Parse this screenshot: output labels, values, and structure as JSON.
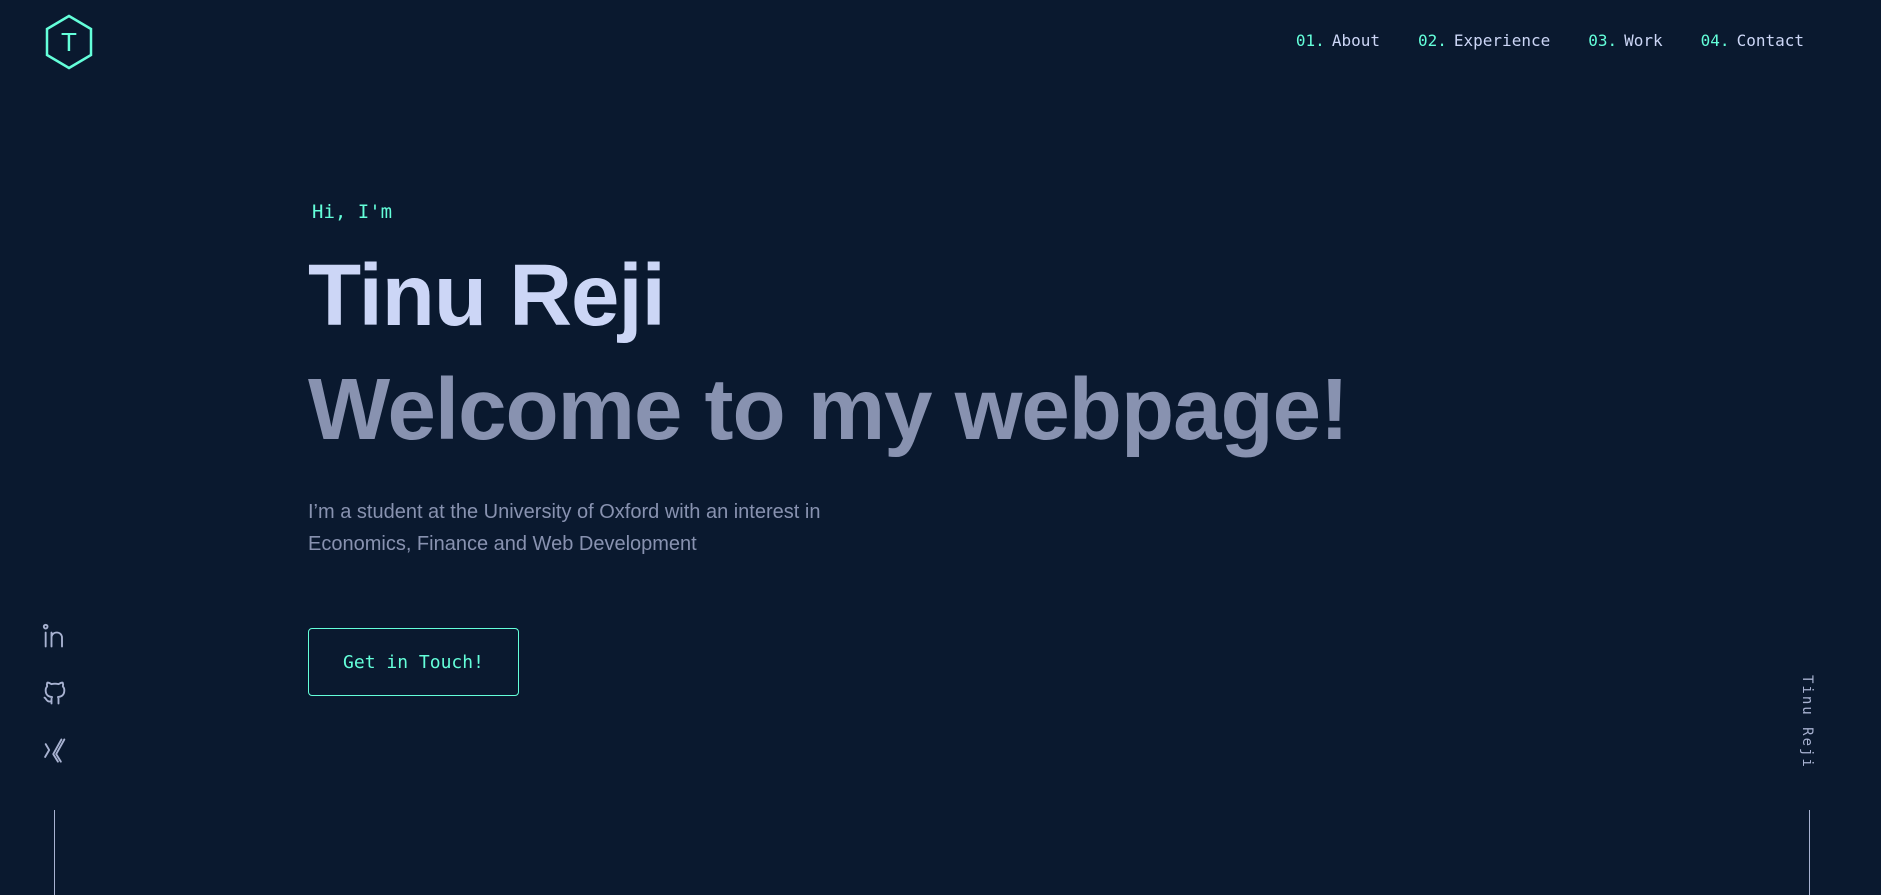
{
  "header": {
    "logo_letter": "T",
    "nav": [
      {
        "num": "01.",
        "label": "About"
      },
      {
        "num": "02.",
        "label": "Experience"
      },
      {
        "num": "03.",
        "label": "Work"
      },
      {
        "num": "04.",
        "label": "Contact"
      }
    ]
  },
  "hero": {
    "greeting": "Hi, I'm",
    "name": "Tinu Reji",
    "tagline": "Welcome to my webpage!",
    "bio": "I’m a student at the University of Oxford with an interest in Economics, Finance and Web Development",
    "cta_label": "Get in Touch!"
  },
  "socials": [
    {
      "icon": "linkedin-icon"
    },
    {
      "icon": "github-icon"
    },
    {
      "icon": "xing-icon"
    }
  ],
  "side": {
    "vertical_name": "Tinu Reji"
  },
  "colors": {
    "background": "#0a192f",
    "accent": "#64ffda",
    "heading": "#ccd6f6",
    "body_text": "#8892b0",
    "light_slate": "#a8b2d1"
  }
}
